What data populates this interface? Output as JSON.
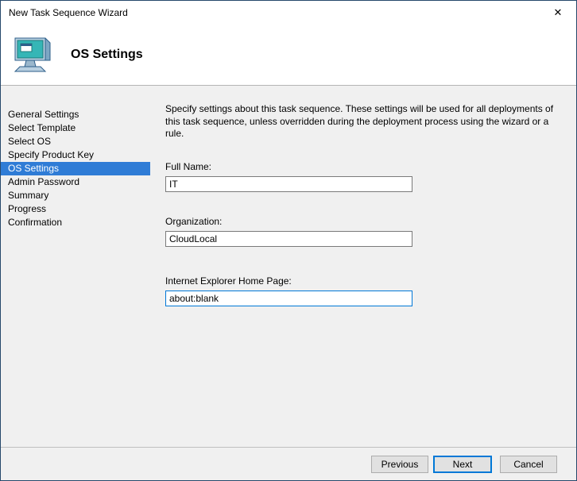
{
  "window": {
    "title": "New Task Sequence Wizard",
    "close_glyph": "✕"
  },
  "header": {
    "title": "OS Settings",
    "icon": "computer-monitor-icon"
  },
  "sidebar": {
    "items": [
      {
        "label": "General Settings",
        "selected": false
      },
      {
        "label": "Select Template",
        "selected": false
      },
      {
        "label": "Select OS",
        "selected": false
      },
      {
        "label": "Specify Product Key",
        "selected": false
      },
      {
        "label": "OS Settings",
        "selected": true
      },
      {
        "label": "Admin Password",
        "selected": false
      },
      {
        "label": "Summary",
        "selected": false
      },
      {
        "label": "Progress",
        "selected": false
      },
      {
        "label": "Confirmation",
        "selected": false
      }
    ]
  },
  "main": {
    "description": "Specify settings about this task sequence.  These settings will be used for all deployments of this task sequence, unless overridden during the deployment process using the wizard or a rule.",
    "fields": [
      {
        "label": "Full Name:",
        "value": "IT",
        "focused": false
      },
      {
        "label": "Organization:",
        "value": "CloudLocal",
        "focused": false
      },
      {
        "label": "Internet Explorer Home Page:",
        "value": "about:blank",
        "focused": true
      }
    ]
  },
  "footer": {
    "previous_label": "Previous",
    "next_label": "Next",
    "cancel_label": "Cancel"
  },
  "colors": {
    "selection_blue": "#2f7cd6",
    "focus_blue": "#0078d7",
    "dialog_background": "#f0f0f0",
    "titlebar_background": "#ffffff"
  }
}
